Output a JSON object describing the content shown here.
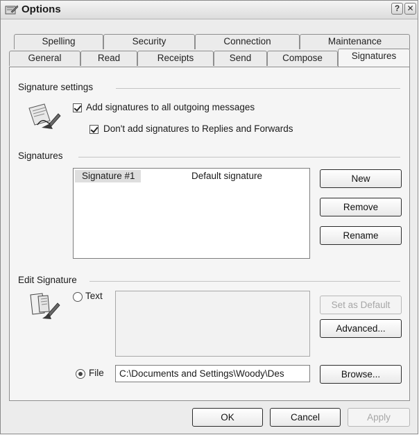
{
  "window": {
    "title": "Options",
    "help_glyph": "?",
    "close_glyph": "✕"
  },
  "tabs_row1": [
    "Spelling",
    "Security",
    "Connection",
    "Maintenance"
  ],
  "tabs_row2": [
    "General",
    "Read",
    "Receipts",
    "Send",
    "Compose",
    "Signatures"
  ],
  "active_tab": "Signatures",
  "signature_settings": {
    "heading": "Signature settings",
    "add_signatures_label": "Add signatures to all outgoing messages",
    "add_signatures_checked": true,
    "no_replies_label": "Don't add signatures to Replies and Forwards",
    "no_replies_checked": true
  },
  "signatures": {
    "heading": "Signatures",
    "list": [
      {
        "name": "Signature #1",
        "description": "Default signature",
        "selected": true
      }
    ],
    "new_label": "New",
    "remove_label": "Remove",
    "rename_label": "Rename"
  },
  "edit_signature": {
    "heading": "Edit Signature",
    "text_option_label": "Text",
    "file_option_label": "File",
    "selected_option": "File",
    "text_value": "",
    "file_path": "C:\\Documents and Settings\\Woody\\Des",
    "set_default_label": "Set as Default",
    "advanced_label": "Advanced...",
    "browse_label": "Browse..."
  },
  "footer": {
    "ok_label": "OK",
    "cancel_label": "Cancel",
    "apply_label": "Apply"
  },
  "icons": {
    "app": "options-app-icon",
    "signature_settings": "signature-pen-icon",
    "edit_signature": "document-pen-icon"
  }
}
